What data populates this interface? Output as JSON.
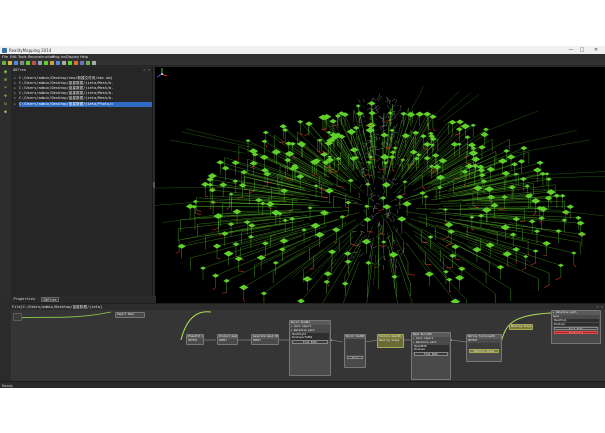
{
  "window": {
    "title": "RealityMapping 2014",
    "minimize": "—",
    "maximize": "□",
    "close": "✕"
  },
  "menu": {
    "items": [
      "File",
      "Edit",
      "Tools",
      "Reconstruction",
      "Plug-Ins",
      "Display",
      "Help"
    ]
  },
  "colors": {
    "accent": "#2f6bc2",
    "wire_green": "#5fd12a",
    "wire_red": "#e0302a",
    "node_yellow": "#7b7b3a",
    "render_button": "#b02020"
  },
  "tree": {
    "title": "DBTree",
    "controls": "▫ ✕",
    "items": [
      {
        "expander": "▸",
        "label": "C:/Users/admin/Desktop/new/新建文件夹/abc.obj"
      },
      {
        "expander": "▸",
        "label": "C:/Users/admin/Desktop/蓝星数据/jieta/Mesh/b-"
      },
      {
        "expander": "▸",
        "label": "C:/Users/admin/Desktop/蓝星数据/jieta/Mesh/b-"
      },
      {
        "expander": "▸",
        "label": "C:/Users/admin/Desktop/蓝星数据/jieta/Mesh/b-"
      },
      {
        "expander": "▸",
        "label": "C:/Users/admin/Desktop/蓝星数据/jieta/Mesh/b-"
      },
      {
        "expander": "▸",
        "label": "C:/Users/admin/Desktop/蓝星数据/jieta/Photo/c"
      }
    ],
    "selected_index": 5
  },
  "tabs": [
    {
      "label": "Properties",
      "active": false
    },
    {
      "label": "DBTree",
      "active": true
    }
  ],
  "graph": {
    "path": "File[C:/Users/admin/Desktop/蓝星数据/jieta]",
    "controls": "▫ ✕",
    "nodes": {
      "import": {
        "title": "Import Mesh"
      },
      "n1": {
        "title": "PlaneFit mesh",
        "out": "OUTPUT"
      },
      "n2": {
        "title": "Project mesh",
        "out": "INPUT"
      },
      "n3": {
        "title": "Generate mesh 3DOG",
        "out": "INPUT"
      },
      "n4": {
        "title": "Build TexOBJ",
        "r1": "▸ Auto import",
        "r2": "▸ Relative path",
        "r3": "MeshHigh3",
        "r4": "Windows/ToOBJ",
        "btn": "Find Path"
      },
      "n5": {
        "title": "Build TexOBJ",
        "btn": "Done"
      },
      "n6": {
        "title": "Texture mesh3D",
        "out": "Meshing Stage"
      },
      "n7": {
        "title": "Mesh Build3D",
        "r1": "▸ Auto import",
        "r2": "▸ Relative path",
        "r3": "MeshOBJ8",
        "r4": "Windows",
        "btn": "Find Path"
      },
      "n8": {
        "title": "Refine Textures3D",
        "out": "OUTPUT",
        "stage": "Meshing Stage"
      },
      "n9": {
        "title": "▸ Relative path",
        "r1": "Save",
        "r2": "MeshHigh",
        "r3": "Windows",
        "btn": "Find Path",
        "btn2": "Rendering"
      },
      "n10": {
        "title": "Meshing Stage"
      }
    },
    "left_node": {
      "title": "Photo",
      "r1": "Relative path",
      "r2": "MeshHigh",
      "r3": "Windows: Top"
    }
  },
  "status": {
    "text": "Ready"
  }
}
